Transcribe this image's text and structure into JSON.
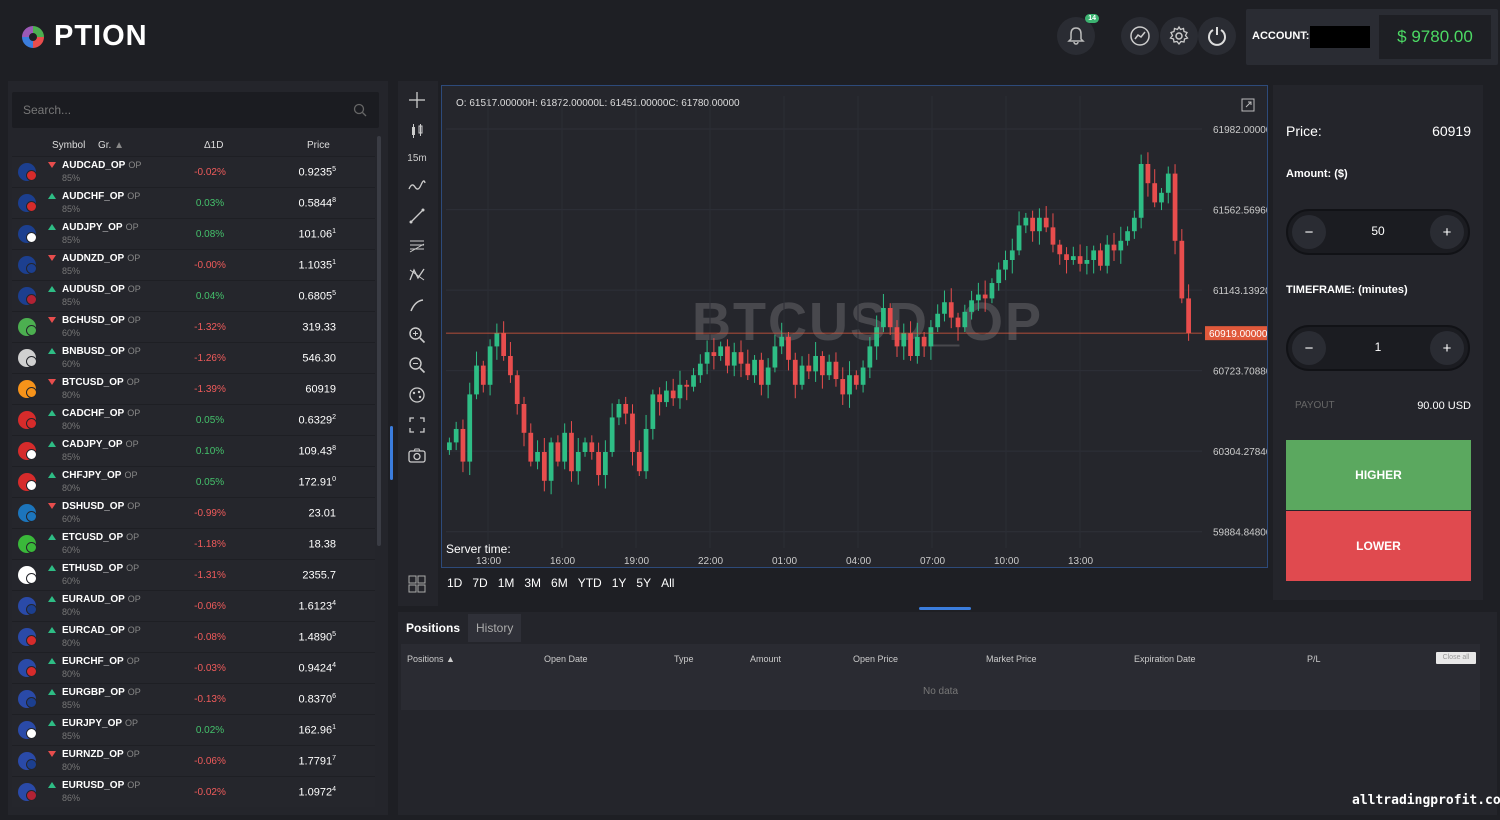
{
  "header": {
    "logo_text": "PTION",
    "notifications_count": "14",
    "account_label": "ACCOUNT:",
    "balance": "$ 9780.00"
  },
  "sidebar": {
    "search_placeholder": "Search...",
    "columns": [
      "Symbol",
      "Gr.",
      "Δ1D",
      "Price"
    ],
    "assets": [
      {
        "symbol": "AUDCAD_OP",
        "tag": "OP",
        "payout": "85%",
        "dir": "down",
        "change": "-0.02%",
        "price": "0.9235",
        "sup": "5",
        "colors": [
          "#1c3f8f",
          "#d62b2b"
        ]
      },
      {
        "symbol": "AUDCHF_OP",
        "tag": "OP",
        "payout": "85%",
        "dir": "up",
        "change": "0.03%",
        "price": "0.5844",
        "sup": "8",
        "colors": [
          "#1c3f8f",
          "#d62b2b"
        ]
      },
      {
        "symbol": "AUDJPY_OP",
        "tag": "OP",
        "payout": "85%",
        "dir": "up",
        "change": "0.08%",
        "price": "101.06",
        "sup": "1",
        "colors": [
          "#1c3f8f",
          "#ffffff"
        ]
      },
      {
        "symbol": "AUDNZD_OP",
        "tag": "OP",
        "payout": "85%",
        "dir": "down",
        "change": "-0.00%",
        "price": "1.1035",
        "sup": "1",
        "colors": [
          "#1c3f8f",
          "#1c3f8f"
        ]
      },
      {
        "symbol": "AUDUSD_OP",
        "tag": "OP",
        "payout": "85%",
        "dir": "up",
        "change": "0.04%",
        "price": "0.6805",
        "sup": "5",
        "colors": [
          "#1c3f8f",
          "#b22234"
        ]
      },
      {
        "symbol": "BCHUSD_OP",
        "tag": "OP",
        "payout": "60%",
        "dir": "down",
        "change": "-1.32%",
        "price": "319.33",
        "sup": "",
        "colors": [
          "#4caf50",
          "#4caf50"
        ]
      },
      {
        "symbol": "BNBUSD_OP",
        "tag": "OP",
        "payout": "60%",
        "dir": "up",
        "change": "-1.26%",
        "price": "546.30",
        "sup": "",
        "colors": [
          "#d0d0d0",
          "#d0d0d0"
        ]
      },
      {
        "symbol": "BTCUSD_OP",
        "tag": "OP",
        "payout": "80%",
        "dir": "down",
        "change": "-1.39%",
        "price": "60919",
        "sup": "",
        "colors": [
          "#f7931a",
          "#f7931a"
        ]
      },
      {
        "symbol": "CADCHF_OP",
        "tag": "OP",
        "payout": "80%",
        "dir": "up",
        "change": "0.05%",
        "price": "0.6329",
        "sup": "2",
        "colors": [
          "#d62b2b",
          "#d62b2b"
        ]
      },
      {
        "symbol": "CADJPY_OP",
        "tag": "OP",
        "payout": "85%",
        "dir": "up",
        "change": "0.10%",
        "price": "109.43",
        "sup": "8",
        "colors": [
          "#d62b2b",
          "#ffffff"
        ]
      },
      {
        "symbol": "CHFJPY_OP",
        "tag": "OP",
        "payout": "80%",
        "dir": "up",
        "change": "0.05%",
        "price": "172.91",
        "sup": "0",
        "colors": [
          "#d62b2b",
          "#ffffff"
        ]
      },
      {
        "symbol": "DSHUSD_OP",
        "tag": "OP",
        "payout": "60%",
        "dir": "down",
        "change": "-0.99%",
        "price": "23.01",
        "sup": "",
        "colors": [
          "#1c75bc",
          "#1c75bc"
        ]
      },
      {
        "symbol": "ETCUSD_OP",
        "tag": "OP",
        "payout": "60%",
        "dir": "up",
        "change": "-1.18%",
        "price": "18.38",
        "sup": "",
        "colors": [
          "#3ab83a",
          "#3ab83a"
        ]
      },
      {
        "symbol": "ETHUSD_OP",
        "tag": "OP",
        "payout": "60%",
        "dir": "up",
        "change": "-1.31%",
        "price": "2355.7",
        "sup": "",
        "colors": [
          "#ffffff",
          "#ffffff"
        ]
      },
      {
        "symbol": "EURAUD_OP",
        "tag": "OP",
        "payout": "80%",
        "dir": "up",
        "change": "-0.06%",
        "price": "1.6123",
        "sup": "4",
        "colors": [
          "#2a4aa8",
          "#1c3f8f"
        ]
      },
      {
        "symbol": "EURCAD_OP",
        "tag": "OP",
        "payout": "80%",
        "dir": "up",
        "change": "-0.08%",
        "price": "1.4890",
        "sup": "5",
        "colors": [
          "#2a4aa8",
          "#d62b2b"
        ]
      },
      {
        "symbol": "EURCHF_OP",
        "tag": "OP",
        "payout": "80%",
        "dir": "up",
        "change": "-0.03%",
        "price": "0.9424",
        "sup": "4",
        "colors": [
          "#2a4aa8",
          "#d62b2b"
        ]
      },
      {
        "symbol": "EURGBP_OP",
        "tag": "OP",
        "payout": "85%",
        "dir": "up",
        "change": "-0.13%",
        "price": "0.8370",
        "sup": "6",
        "colors": [
          "#2a4aa8",
          "#1c3f8f"
        ]
      },
      {
        "symbol": "EURJPY_OP",
        "tag": "OP",
        "payout": "85%",
        "dir": "up",
        "change": "0.02%",
        "price": "162.96",
        "sup": "1",
        "colors": [
          "#2a4aa8",
          "#ffffff"
        ]
      },
      {
        "symbol": "EURNZD_OP",
        "tag": "OP",
        "payout": "80%",
        "dir": "down",
        "change": "-0.06%",
        "price": "1.7791",
        "sup": "7",
        "colors": [
          "#2a4aa8",
          "#1c3f8f"
        ]
      },
      {
        "symbol": "EURUSD_OP",
        "tag": "OP",
        "payout": "86%",
        "dir": "up",
        "change": "-0.02%",
        "price": "1.0972",
        "sup": "4",
        "colors": [
          "#2a4aa8",
          "#b22234"
        ]
      }
    ]
  },
  "toolbar": {
    "timeframe_label": "15m",
    "icons": [
      "crosshair-icon",
      "candles-icon",
      "timeframe",
      "indicator-icon",
      "trendline-icon",
      "fib-icon",
      "pattern-icon",
      "brush-icon",
      "zoom-in-icon",
      "zoom-out-icon",
      "theme-icon",
      "fullscreen-icon",
      "camera-icon"
    ]
  },
  "chart": {
    "ohlc_text": "O: 61517.00000H: 61872.00000L: 61451.00000C: 61780.00000",
    "watermark": "BTCUSD_OP",
    "server_time_label": "Server time:",
    "current_price_label": "60919.00000",
    "ranges": [
      "1D",
      "7D",
      "1M",
      "3M",
      "6M",
      "YTD",
      "1Y",
      "5Y",
      "All"
    ]
  },
  "chart_data": {
    "type": "candlestick",
    "x_ticks": [
      "13:00",
      "16:00",
      "19:00",
      "22:00",
      "01:00",
      "04:00",
      "07:00",
      "10:00",
      "13:00"
    ],
    "y_ticks": [
      "61982.00000",
      "61562.56960",
      "61143.13920",
      "60723.70880",
      "60304.27840",
      "59884.84800"
    ],
    "ylim": [
      59800,
      62050
    ],
    "current_price": 60919,
    "closes": [
      60350,
      60420,
      60250,
      60600,
      60750,
      60650,
      60850,
      60920,
      60800,
      60700,
      60550,
      60400,
      60250,
      60300,
      60150,
      60350,
      60250,
      60400,
      60200,
      60300,
      60350,
      60300,
      60180,
      60300,
      60480,
      60550,
      60500,
      60300,
      60200,
      60420,
      60600,
      60560,
      60620,
      60580,
      60650,
      60640,
      60700,
      60760,
      60820,
      60800,
      60850,
      60750,
      60820,
      60760,
      60700,
      60780,
      60650,
      60740,
      60850,
      60900,
      60780,
      60650,
      60750,
      60720,
      60800,
      60700,
      60770,
      60680,
      60600,
      60700,
      60650,
      60740,
      60850,
      60950,
      61050,
      60950,
      60850,
      60920,
      60800,
      60900,
      60850,
      60950,
      61020,
      61080,
      61000,
      60950,
      61030,
      61090,
      61120,
      61100,
      61180,
      61250,
      61300,
      61350,
      61480,
      61520,
      61450,
      61520,
      61470,
      61380,
      61330,
      61300,
      61320,
      61280,
      61300,
      61350,
      61270,
      61380,
      61350,
      61400,
      61450,
      61520,
      61800,
      61700,
      61600,
      61650,
      61750,
      61400,
      61100,
      60919
    ]
  },
  "trade_panel": {
    "price_label": "Price:",
    "price_value": "60919",
    "amount_label": "Amount: ($)",
    "amount_value": "50",
    "timeframe_label": "TIMEFRAME: (minutes)",
    "timeframe_value": "1",
    "payout_label": "PAYOUT",
    "payout_value": "90.00 USD",
    "higher_label": "HIGHER",
    "lower_label": "LOWER",
    "minus": "−",
    "plus": "+"
  },
  "positions": {
    "tabs": [
      "Positions",
      "History"
    ],
    "columns": [
      "Positions ▲",
      "Open Date",
      "Type",
      "Amount",
      "Open Price",
      "Market Price",
      "Expiration Date",
      "P/L"
    ],
    "close_all": "Close all",
    "empty_text": "No data"
  },
  "watermark_site": "alltradingprofit.com",
  "colors": {
    "up": "#2ebd85",
    "down": "#e84d4d",
    "accent": "#3b7ddd"
  }
}
